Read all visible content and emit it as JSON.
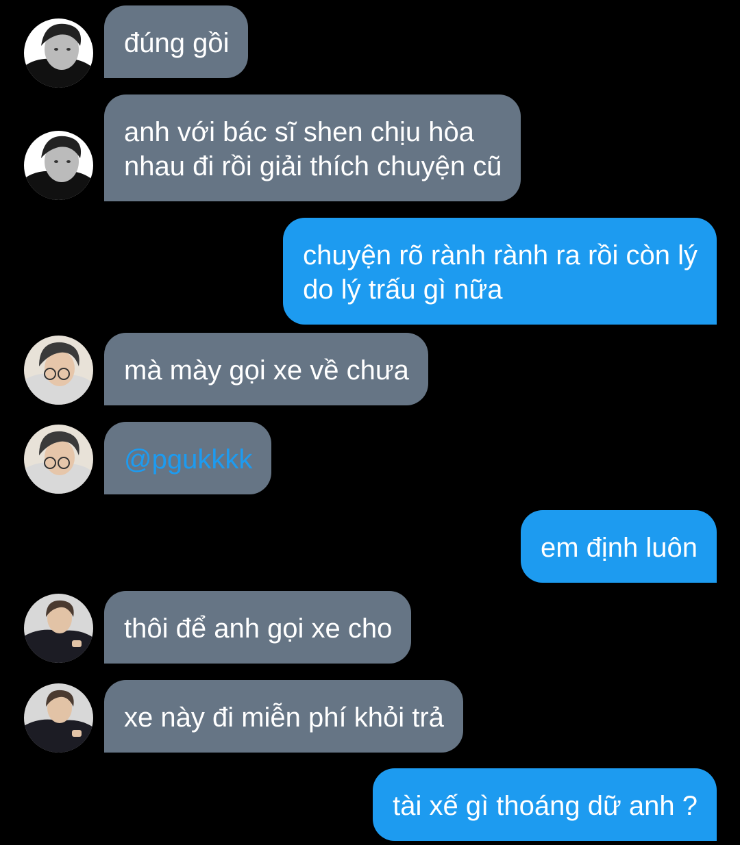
{
  "conversation": {
    "messages": [
      {
        "sender": "other",
        "avatar": "avatar-bw-boy",
        "text": "đúng gồi"
      },
      {
        "sender": "other",
        "avatar": "avatar-bw-boy",
        "lines": [
          "anh với bác sĩ shen chịu hòa",
          "nhau đi rồi giải thích chuyện cũ"
        ]
      },
      {
        "sender": "me",
        "lines": [
          "chuyện rõ rành rành ra rồi còn lý",
          "do lý trấu gì nữa"
        ]
      },
      {
        "sender": "other",
        "avatar": "avatar-glasses-boy",
        "text": "mà mày gọi xe về chưa"
      },
      {
        "sender": "other",
        "avatar": "avatar-glasses-boy",
        "text": "@pgukkkk"
      },
      {
        "sender": "me",
        "text": "em định luôn"
      },
      {
        "sender": "other",
        "avatar": "avatar-suit-man",
        "text": "thôi để anh gọi xe cho"
      },
      {
        "sender": "other",
        "avatar": "avatar-suit-man",
        "text": "xe này đi miễn phí khỏi trả"
      },
      {
        "sender": "me",
        "text": "tài xế gì thoáng dữ anh ?"
      }
    ]
  },
  "colors": {
    "background": "#000000",
    "received_bubble": "#667585",
    "sent_bubble": "#1d9bf0",
    "mention": "#1d9bf0"
  }
}
